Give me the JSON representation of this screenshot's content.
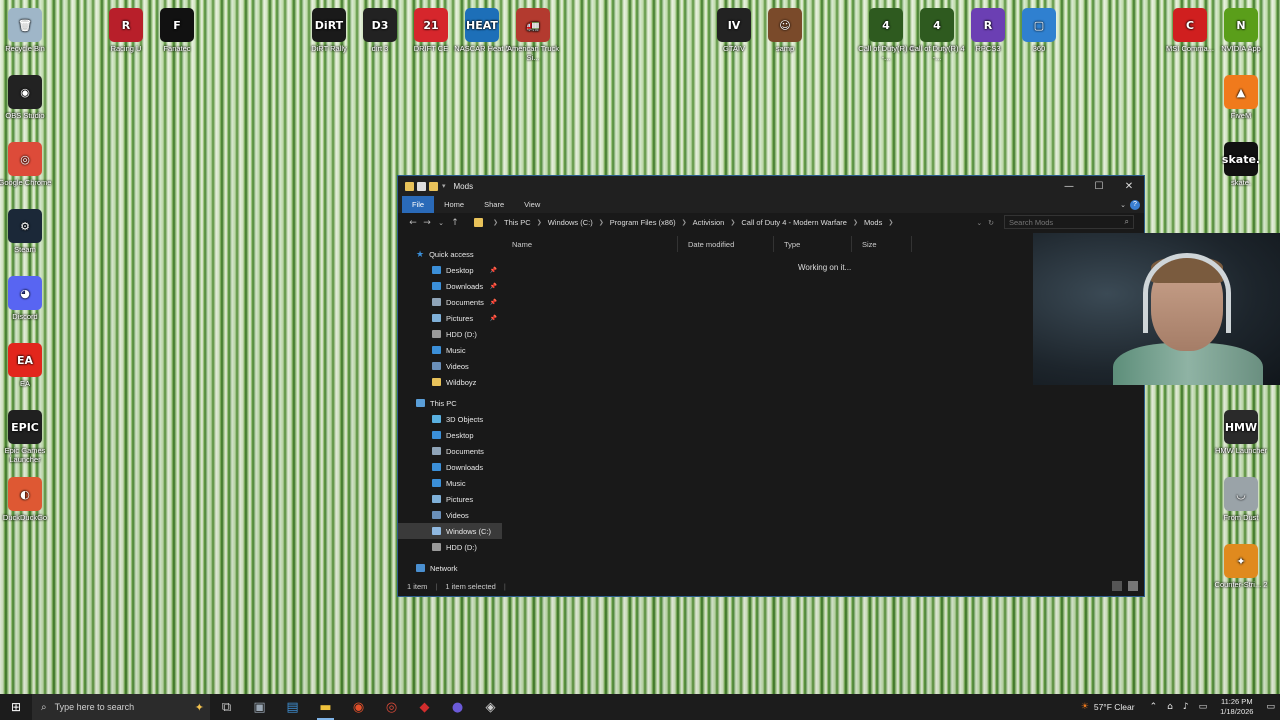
{
  "desktop": {
    "icons": [
      {
        "label": "Recycle Bin",
        "glyph": "🗑",
        "color": "#9fb6c8"
      },
      {
        "label": "Racing U",
        "glyph": "R",
        "color": "#b81f2a"
      },
      {
        "label": "Fanatec",
        "glyph": "F",
        "color": "#111111"
      },
      {
        "label": "DiRT Rally",
        "glyph": "DiRT",
        "color": "#1a1a1a"
      },
      {
        "label": "dirt 3",
        "glyph": "D3",
        "color": "#222222"
      },
      {
        "label": "DRIFT CE",
        "glyph": "21",
        "color": "#d6262c"
      },
      {
        "label": "NASCAR Heat 5",
        "glyph": "HEAT",
        "color": "#1d6fb8"
      },
      {
        "label": "American Truck Si...",
        "glyph": "🚛",
        "color": "#b33a2f"
      },
      {
        "label": "GTAIV",
        "glyph": "IV",
        "color": "#222222"
      },
      {
        "label": "samp",
        "glyph": "☺",
        "color": "#7a4a2a"
      },
      {
        "label": "Call of Duty(R) 4 -...",
        "glyph": "4",
        "color": "#2e5a1f"
      },
      {
        "label": "Call of Duty(R) 4 -...",
        "glyph": "4",
        "color": "#2e5a1f"
      },
      {
        "label": "RPCS3",
        "glyph": "R",
        "color": "#6b3fb3"
      },
      {
        "label": "360",
        "glyph": "▢",
        "color": "#2f80d0"
      },
      {
        "label": "MSI Comma...",
        "glyph": "C",
        "color": "#d01f1f"
      },
      {
        "label": "NVIDIA App",
        "glyph": "N",
        "color": "#5a9e1a"
      },
      {
        "label": "OBS Studio",
        "glyph": "◉",
        "color": "#222222"
      },
      {
        "label": "FiveM",
        "glyph": "▲",
        "color": "#f07a1c"
      },
      {
        "label": "Google Chrome",
        "glyph": "◎",
        "color": "#dd4b39"
      },
      {
        "label": "skate.",
        "glyph": "skate.",
        "color": "#111111"
      },
      {
        "label": "Steam",
        "glyph": "⚙",
        "color": "#1b2838"
      },
      {
        "label": "Discord",
        "glyph": "◕",
        "color": "#5865f2"
      },
      {
        "label": "EA",
        "glyph": "EA",
        "color": "#e2261c"
      },
      {
        "label": "Epic Games Launcher",
        "glyph": "EPIC",
        "color": "#202020"
      },
      {
        "label": "HMW Launcher",
        "glyph": "HMW",
        "color": "#2a2a2a"
      },
      {
        "label": "DuckDuckGo",
        "glyph": "◐",
        "color": "#de5833"
      },
      {
        "label": "From Dust",
        "glyph": "◡",
        "color": "#9aa3a8"
      },
      {
        "label": "Counter-Stri... 2",
        "glyph": "✦",
        "color": "#e08a1e"
      }
    ]
  },
  "explorer": {
    "title": "Mods",
    "tabs": {
      "file": "File",
      "home": "Home",
      "share": "Share",
      "view": "View"
    },
    "breadcrumb": [
      "This PC",
      "Windows (C:)",
      "Program Files (x86)",
      "Activision",
      "Call of Duty 4 - Modern Warfare",
      "Mods"
    ],
    "search_placeholder": "Search Mods",
    "quick_access": {
      "header": "Quick access",
      "items": [
        {
          "label": "Desktop",
          "pinned": true,
          "color": "#3b8fd8"
        },
        {
          "label": "Downloads",
          "pinned": true,
          "color": "#3b8fd8"
        },
        {
          "label": "Documents",
          "pinned": true,
          "color": "#8fa4b8"
        },
        {
          "label": "Pictures",
          "pinned": true,
          "color": "#7fb0d8"
        },
        {
          "label": "HDD (D:)",
          "pinned": false,
          "color": "#9a9a9a"
        },
        {
          "label": "Music",
          "pinned": false,
          "color": "#3b8fd8"
        },
        {
          "label": "Videos",
          "pinned": false,
          "color": "#6a8fb8"
        },
        {
          "label": "Wildboyz",
          "pinned": false,
          "color": "#e8c25a"
        }
      ]
    },
    "this_pc": {
      "header": "This PC",
      "items": [
        {
          "label": "3D Objects",
          "color": "#5ab0e0"
        },
        {
          "label": "Desktop",
          "color": "#3b8fd8"
        },
        {
          "label": "Documents",
          "color": "#8fa4b8"
        },
        {
          "label": "Downloads",
          "color": "#3b8fd8"
        },
        {
          "label": "Music",
          "color": "#3b8fd8"
        },
        {
          "label": "Pictures",
          "color": "#7fb0d8"
        },
        {
          "label": "Videos",
          "color": "#6a8fb8"
        },
        {
          "label": "Windows (C:)",
          "color": "#8fb8e0",
          "selected": true
        },
        {
          "label": "HDD (D:)",
          "color": "#9a9a9a"
        }
      ]
    },
    "network": "Network",
    "columns": {
      "name": "Name",
      "date": "Date modified",
      "type": "Type",
      "size": "Size"
    },
    "working": "Working on it...",
    "status": {
      "items": "1 item",
      "selected": "1 item selected"
    }
  },
  "taskbar": {
    "search_placeholder": "Type here to search",
    "apps": [
      {
        "name": "task-view",
        "glyph": "⧉",
        "color": "#cccccc"
      },
      {
        "name": "app-1",
        "glyph": "▣",
        "color": "#9aa7b4"
      },
      {
        "name": "app-2",
        "glyph": "▤",
        "color": "#3e8ed0"
      },
      {
        "name": "file-explorer",
        "glyph": "▬",
        "color": "#f0c23b",
        "active": true
      },
      {
        "name": "app-4",
        "glyph": "◉",
        "color": "#e5502a"
      },
      {
        "name": "chrome",
        "glyph": "◎",
        "color": "#dd4b39"
      },
      {
        "name": "app-6",
        "glyph": "◆",
        "color": "#d22d2d"
      },
      {
        "name": "app-7",
        "glyph": "●",
        "color": "#6b5ad8"
      },
      {
        "name": "app-8",
        "glyph": "◈",
        "color": "#cfcfcf"
      }
    ],
    "weather": "57°F  Clear",
    "time": "11:26 PM",
    "date": "1/18/2026"
  }
}
